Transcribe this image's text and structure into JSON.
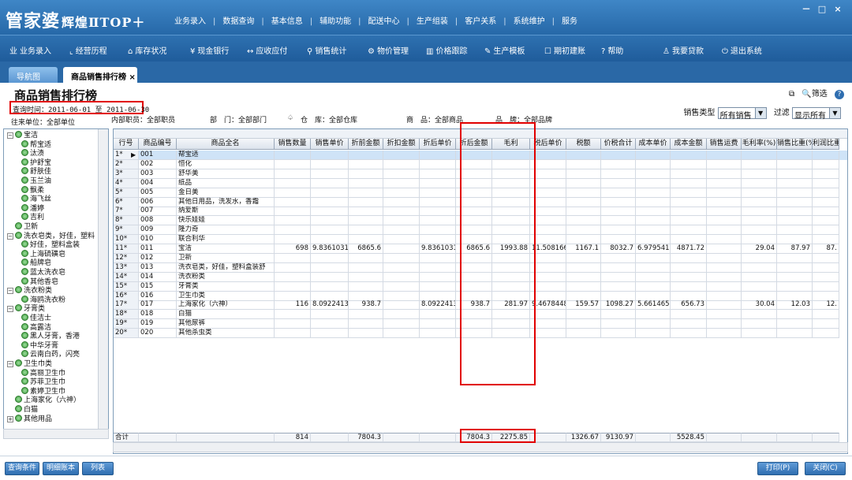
{
  "app": {
    "logo_main": "管家婆",
    "logo_sub": "辉煌ⅡTOP＋",
    "top_menu": [
      "业务录入",
      "数据查询",
      "基本信息",
      "辅助功能",
      "配送中心",
      "生产组装",
      "客户关系",
      "系统维护",
      "服务"
    ],
    "window_controls": [
      "－",
      "□",
      "×"
    ]
  },
  "toolbar": {
    "items": [
      {
        "icon": "业",
        "label": "业务录入"
      },
      {
        "icon": "⌞",
        "label": "经营历程"
      },
      {
        "icon": "⌂",
        "label": "库存状况"
      },
      {
        "icon": "¥",
        "label": "现金银行"
      },
      {
        "icon": "↔",
        "label": "应收应付"
      },
      {
        "icon": "⚲",
        "label": "销售统计"
      },
      {
        "icon": "⚙",
        "label": "物价管理"
      },
      {
        "icon": "▥",
        "label": "价格跟踪"
      },
      {
        "icon": "✎",
        "label": "生产模板"
      },
      {
        "icon": "☐",
        "label": "期初建账"
      },
      {
        "icon": "?",
        "label": "帮助"
      },
      {
        "icon": "♙",
        "label": "我要贷款"
      },
      {
        "icon": "⏻",
        "label": "退出系统"
      }
    ]
  },
  "tabs": {
    "nav": "导航图",
    "rank": "商品销售排行榜",
    "rank_close": "×"
  },
  "page": {
    "title": "商品销售排行榜",
    "query_time": "查询时间：2011-06-01 至 2011-06-30",
    "filter_label": "筛选",
    "help_icon": "?",
    "sales_type_label": "销售类型",
    "sales_type_value": "所有销售",
    "filter2_label": "过滤",
    "filter2_value": "显示所有",
    "info": {
      "unit": "往来单位：全部单位",
      "staff": "内部职员：全部职员",
      "dept": "部　门：全部部门",
      "store": "仓　库：全部仓库",
      "goods": "商　品：全部商品",
      "brand": "品　牌：全部品牌",
      "store_icon": "♤"
    }
  },
  "tree": [
    {
      "label": "宝洁",
      "level": 0,
      "pm": "⊖"
    },
    {
      "label": "帮宝适",
      "level": 1
    },
    {
      "label": "汰渍",
      "level": 1
    },
    {
      "label": "护舒宝",
      "level": 1
    },
    {
      "label": "舒肤佳",
      "level": 1
    },
    {
      "label": "玉兰油",
      "level": 1
    },
    {
      "label": "飘柔",
      "level": 1
    },
    {
      "label": "海飞丝",
      "level": 1
    },
    {
      "label": "潘婷",
      "level": 1
    },
    {
      "label": "吉利",
      "level": 1
    },
    {
      "label": "卫新",
      "level": 0,
      "pm": ""
    },
    {
      "label": "洗衣皂类，好佳，塑料",
      "level": 0,
      "pm": "⊖"
    },
    {
      "label": "好佳，塑料盒装",
      "level": 1
    },
    {
      "label": "上海硫磺皂",
      "level": 1
    },
    {
      "label": "船牌皂",
      "level": 1
    },
    {
      "label": "蓝太洗衣皂",
      "level": 1
    },
    {
      "label": "其他香皂",
      "level": 1
    },
    {
      "label": "洗衣粉类",
      "level": 0,
      "pm": "⊖"
    },
    {
      "label": "海鸥洗衣粉",
      "level": 1
    },
    {
      "label": "牙膏类",
      "level": 0,
      "pm": "⊖"
    },
    {
      "label": "佳洁士",
      "level": 1
    },
    {
      "label": "高露洁",
      "level": 1
    },
    {
      "label": "黑人牙膏，香港",
      "level": 1
    },
    {
      "label": "中华牙膏",
      "level": 1
    },
    {
      "label": "云南白药，闪亮",
      "level": 1
    },
    {
      "label": "卫生巾类",
      "level": 0,
      "pm": "⊖"
    },
    {
      "label": "高丽卫生巾",
      "level": 1
    },
    {
      "label": "苏菲卫生巾",
      "level": 1
    },
    {
      "label": "素婷卫生巾",
      "level": 1
    },
    {
      "label": "上海家化（六神）",
      "level": 0,
      "pm": ""
    },
    {
      "label": "白猫",
      "level": 0,
      "pm": ""
    },
    {
      "label": "其他用品",
      "level": 0,
      "pm": "⊕"
    }
  ],
  "grid": {
    "headers": [
      "行号",
      "商品编号",
      "商品全名",
      "销售数量",
      "销售单价",
      "折前金额",
      "折扣金额",
      "折后单价",
      "折后金额",
      "毛利",
      "税后单价",
      "税额",
      "价税合计",
      "成本单价",
      "成本金额",
      "销售运费",
      "毛利率(%)",
      "销售比重(%)",
      "利润比重(%)"
    ],
    "rows": [
      [
        "1*",
        "001",
        "帮宝适",
        "",
        "",
        "",
        "",
        "",
        "",
        "",
        "",
        "",
        "",
        "",
        "",
        "",
        "",
        "",
        ""
      ],
      [
        "2*",
        "002",
        "恒化",
        "",
        "",
        "",
        "",
        "",
        "",
        "",
        "",
        "",
        "",
        "",
        "",
        "",
        "",
        "",
        ""
      ],
      [
        "3*",
        "003",
        "舒华美",
        "",
        "",
        "",
        "",
        "",
        "",
        "",
        "",
        "",
        "",
        "",
        "",
        "",
        "",
        "",
        ""
      ],
      [
        "4*",
        "004",
        "纸品",
        "",
        "",
        "",
        "",
        "",
        "",
        "",
        "",
        "",
        "",
        "",
        "",
        "",
        "",
        "",
        ""
      ],
      [
        "5*",
        "005",
        "金日美",
        "",
        "",
        "",
        "",
        "",
        "",
        "",
        "",
        "",
        "",
        "",
        "",
        "",
        "",
        "",
        ""
      ],
      [
        "6*",
        "006",
        "其他日用品，洗发水，香霜",
        "",
        "",
        "",
        "",
        "",
        "",
        "",
        "",
        "",
        "",
        "",
        "",
        "",
        "",
        "",
        ""
      ],
      [
        "7*",
        "007",
        "纳爱斯",
        "",
        "",
        "",
        "",
        "",
        "",
        "",
        "",
        "",
        "",
        "",
        "",
        "",
        "",
        "",
        ""
      ],
      [
        "8*",
        "008",
        "快乐娃娃",
        "",
        "",
        "",
        "",
        "",
        "",
        "",
        "",
        "",
        "",
        "",
        "",
        "",
        "",
        "",
        ""
      ],
      [
        "9*",
        "009",
        "隆力奇",
        "",
        "",
        "",
        "",
        "",
        "",
        "",
        "",
        "",
        "",
        "",
        "",
        "",
        "",
        "",
        ""
      ],
      [
        "10*",
        "010",
        "联合利华",
        "",
        "",
        "",
        "",
        "",
        "",
        "",
        "",
        "",
        "",
        "",
        "",
        "",
        "",
        "",
        ""
      ],
      [
        "11*",
        "011",
        "宝洁",
        "698",
        "9.83610315",
        "6865.6",
        "",
        "9.83610315",
        "6865.6",
        "1993.88",
        "11.5081661",
        "1167.1",
        "8032.7",
        "6.97954155",
        "4871.72",
        "",
        "29.04",
        "87.97",
        "87."
      ],
      [
        "12*",
        "012",
        "卫新",
        "",
        "",
        "",
        "",
        "",
        "",
        "",
        "",
        "",
        "",
        "",
        "",
        "",
        "",
        "",
        ""
      ],
      [
        "13*",
        "013",
        "洗衣皂类，好佳，塑料盒装舒",
        "",
        "",
        "",
        "",
        "",
        "",
        "",
        "",
        "",
        "",
        "",
        "",
        "",
        "",
        "",
        ""
      ],
      [
        "14*",
        "014",
        "洗衣粉类",
        "",
        "",
        "",
        "",
        "",
        "",
        "",
        "",
        "",
        "",
        "",
        "",
        "",
        "",
        "",
        ""
      ],
      [
        "15*",
        "015",
        "牙膏类",
        "",
        "",
        "",
        "",
        "",
        "",
        "",
        "",
        "",
        "",
        "",
        "",
        "",
        "",
        "",
        ""
      ],
      [
        "16*",
        "016",
        "卫生巾类",
        "",
        "",
        "",
        "",
        "",
        "",
        "",
        "",
        "",
        "",
        "",
        "",
        "",
        "",
        "",
        ""
      ],
      [
        "17*",
        "017",
        "上海家化（六神）",
        "116",
        "8.09224138",
        "938.7",
        "",
        "8.09224138",
        "938.7",
        "281.97",
        "9.46784483",
        "159.57",
        "1098.27",
        "5.66146552",
        "656.73",
        "",
        "30.04",
        "12.03",
        "12."
      ],
      [
        "18*",
        "018",
        "白猫",
        "",
        "",
        "",
        "",
        "",
        "",
        "",
        "",
        "",
        "",
        "",
        "",
        "",
        "",
        "",
        ""
      ],
      [
        "19*",
        "019",
        "其他尿裤",
        "",
        "",
        "",
        "",
        "",
        "",
        "",
        "",
        "",
        "",
        "",
        "",
        "",
        "",
        "",
        ""
      ],
      [
        "20*",
        "020",
        "其他杀虫类",
        "",
        "",
        "",
        "",
        "",
        "",
        "",
        "",
        "",
        "",
        "",
        "",
        "",
        "",
        "",
        ""
      ]
    ],
    "total": [
      "合计",
      "",
      "",
      "814",
      "",
      "7804.3",
      "",
      "",
      "7804.3",
      "2275.85",
      "",
      "1326.67",
      "9130.97",
      "",
      "5528.45",
      "",
      "",
      "",
      ""
    ]
  },
  "bottom": {
    "left_buttons": [
      "查询条件",
      "明细账本",
      "列表"
    ],
    "right_buttons": [
      "打印(P)",
      "关闭(C)"
    ]
  }
}
